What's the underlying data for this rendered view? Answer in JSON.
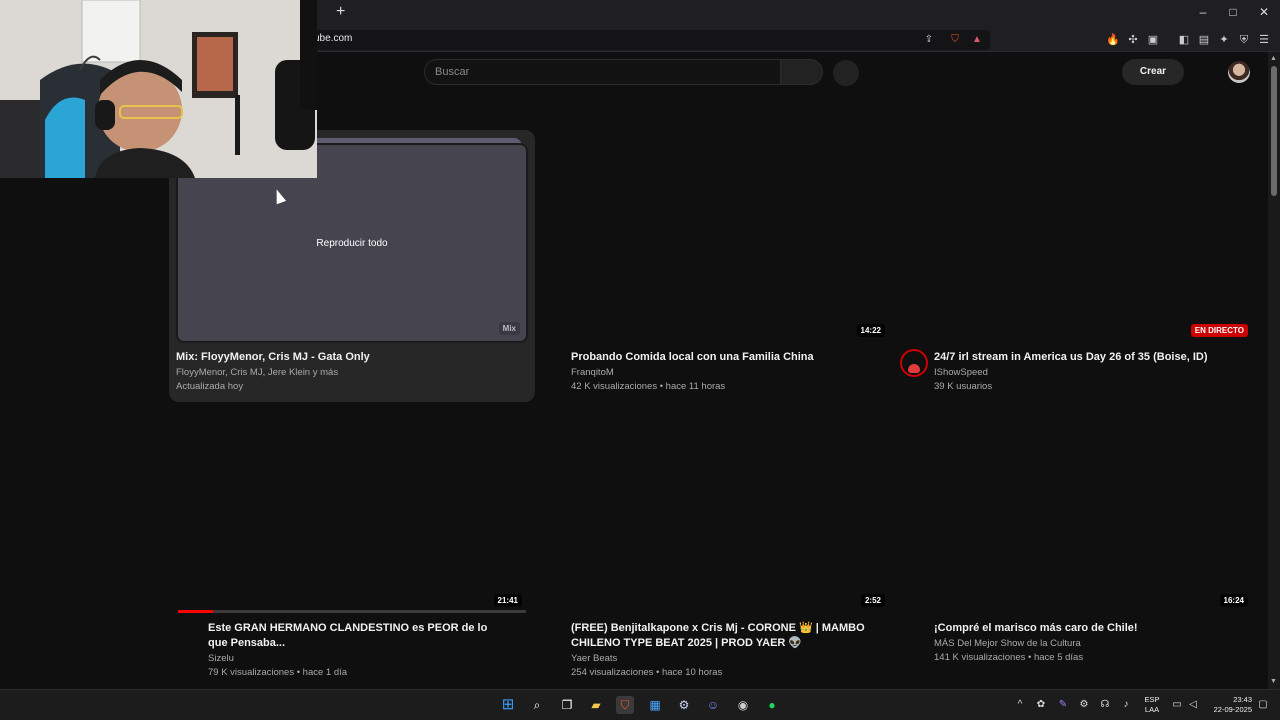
{
  "browser": {
    "url": "ube.com",
    "new_tab_icon": "+",
    "window_controls": [
      "–",
      "□",
      "✕"
    ]
  },
  "header": {
    "search_placeholder": "Buscar",
    "create_label": "Crear"
  },
  "cards": [
    {
      "title": "Mix: FloyyMenor, Cris MJ - Gata Only",
      "channel": "FloyyMenor, Cris MJ, Jere Klein y más",
      "stats": "Actualizada hoy",
      "overlay_label": "Reproducir todo",
      "badge": "Mix"
    },
    {
      "title": "Probando Comida local con una Familia China",
      "channel": "FranqitoM",
      "stats": "42 K visualizaciones • hace 11 horas",
      "duration": "14:22"
    },
    {
      "title": "24/7 irl stream in America us Day 26 of 35 (Boise, ID)",
      "channel": "IShowSpeed",
      "stats": "39 K usuarios",
      "badge": "EN DIRECTO"
    },
    {
      "title": "Este GRAN HERMANO CLANDESTINO es PEOR de lo que Pensaba...",
      "channel": "Sizelu",
      "stats": "79 K visualizaciones • hace 1 día",
      "duration": "21:41",
      "watched_fraction": 0.1
    },
    {
      "title": "(FREE) Benjitalkapone x Cris Mj - CORONE 👑 | MAMBO CHILENO TYPE BEAT 2025 | PROD YAER 👽",
      "channel": "Yaer Beats",
      "stats": "254 visualizaciones • hace 10 horas",
      "duration": "2:52"
    },
    {
      "title": "¡Compré el marisco más caro de Chile!",
      "channel": "MÁS Del Mejor Show de la Cultura",
      "stats": "141 K visualizaciones • hace 5 días",
      "duration": "16:24"
    }
  ],
  "taskbar": {
    "lang_1": "ESP",
    "lang_2": "LAA",
    "time": "23:43",
    "date": "22-09-2025"
  },
  "colors": {
    "live_red": "#cc0000",
    "progress_red": "#ff0000",
    "background": "#0f0f0f"
  }
}
